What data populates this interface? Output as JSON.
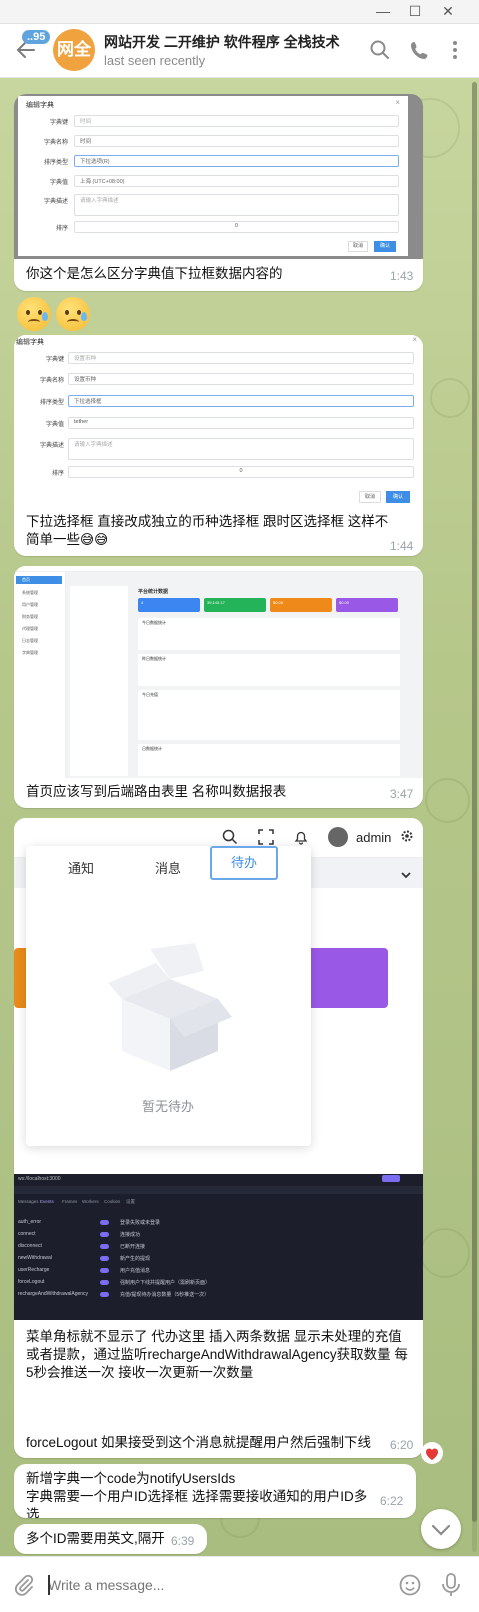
{
  "chat": {
    "title": "网站开发 二开维护 软件程序 全栈技术",
    "status": "last seen recently",
    "avatar_text": "网全",
    "unread_count": "..95"
  },
  "dialog1": {
    "title": "编辑字典",
    "close": "×",
    "labels": [
      "字典键",
      "字典名称",
      "排序类型",
      "字典值",
      "字典描述",
      "排序"
    ],
    "required": "*",
    "values": [
      "时间",
      "时间",
      "下拉选项(R)",
      "上海 (UTC+08:00)",
      "请输入字典描述",
      "0"
    ],
    "cancel": "取消",
    "confirm": "确认"
  },
  "dialog2": {
    "title": "编辑字典",
    "close": "×",
    "labels": [
      "字典键",
      "字典名称",
      "排序类型",
      "字典值",
      "字典描述",
      "排序"
    ],
    "required": "*",
    "values": [
      "设置币种",
      "设置币种",
      "下拉选择框",
      "tether",
      "请输入字典描述",
      "0"
    ],
    "cancel": "取消",
    "confirm": "确认"
  },
  "messages": [
    {
      "text": "你这个是怎么区分字典值下拉框数据内容的",
      "time": "1:43"
    },
    {
      "text": "下拉选择框 直接改成独立的币种选择框 跟时区选择框 这样不简单一些😅😅",
      "time": "1:44"
    },
    {
      "text": "首页应该写到后端路由表里 名称叫数据报表",
      "time": "3:47"
    },
    {
      "text": "菜单角标就不显示了 代办这里 插入两条数据 显示未处理的充值或者提款，通过监听rechargeAndWithdrawalAgency获取数量 每5秒会推送一次 接收一次更新一次数量",
      "text2": "forceLogout 如果接受到这个消息就提醒用户然后强制下线",
      "time": "6:20"
    },
    {
      "text": "新增字典一个code为notifyUsersIds",
      "text2": "字典需要一个用户ID选择框 选择需要接收通知的用户ID多选",
      "time": "6:22"
    },
    {
      "text": "多个ID需要用英文,隔开",
      "time": "6:39"
    }
  ],
  "dashboard": {
    "menu": [
      "首页",
      "系统管理",
      "用户管理",
      "财务管理",
      "代理管理",
      "日志管理",
      "字典管理"
    ],
    "title": "平台统计数据",
    "cards": [
      {
        "label": "注册人数",
        "value": "4",
        "color": "#3b86f0"
      },
      {
        "label": "充值总额",
        "value": "39,143.17",
        "color": "#25b35a"
      },
      {
        "label": "提现总额",
        "value": "$0.00",
        "color": "#ef8a1a"
      },
      {
        "label": "平台盈利",
        "value": "$0.00",
        "color": "#9a58e6"
      }
    ],
    "sections": [
      "今日数据统计",
      "昨日数据统计",
      "今日充值",
      "日数据统计"
    ],
    "stats": [
      "39,143.17",
      "$0.00",
      "$0.00",
      "$0.00"
    ]
  },
  "notify_panel": {
    "toolbar_user": "admin",
    "tabs": [
      "通知",
      "消息",
      "待办"
    ],
    "active_tab": "待办",
    "empty_text": "暂无待办"
  },
  "devtools": {
    "url": "ws://localhost:3000",
    "tabs": [
      "Messages",
      "Events",
      "Frames",
      "Workers",
      "Cookies",
      "设置"
    ],
    "rows": [
      {
        "name": "auth_error",
        "desc": "登录失败或未登录"
      },
      {
        "name": "connect",
        "desc": "连接成功"
      },
      {
        "name": "disconnect",
        "desc": "已断开连接"
      },
      {
        "name": "newWithdrawal",
        "desc": "新产生的提现"
      },
      {
        "name": "userRecharge",
        "desc": "用户充值消息"
      },
      {
        "name": "forceLogout",
        "desc": "强制用户下线并提醒用户（需刷新页面）"
      },
      {
        "name": "rechargeAndWithdrawalAgency",
        "desc": "充值/提现待办消息数量（5秒推送一次）"
      }
    ]
  },
  "composer": {
    "placeholder": "Write a message..."
  },
  "colors": {
    "accent": "#3f8ee6",
    "bubble": "#ffffff",
    "time": "#9aa4a9",
    "background": "#b9c98e"
  },
  "icons": [
    "back-arrow-icon",
    "search-icon",
    "phone-icon",
    "more-vert-icon",
    "attach-icon",
    "emoji-icon",
    "mic-icon",
    "chevron-down-icon",
    "heart-icon"
  ]
}
